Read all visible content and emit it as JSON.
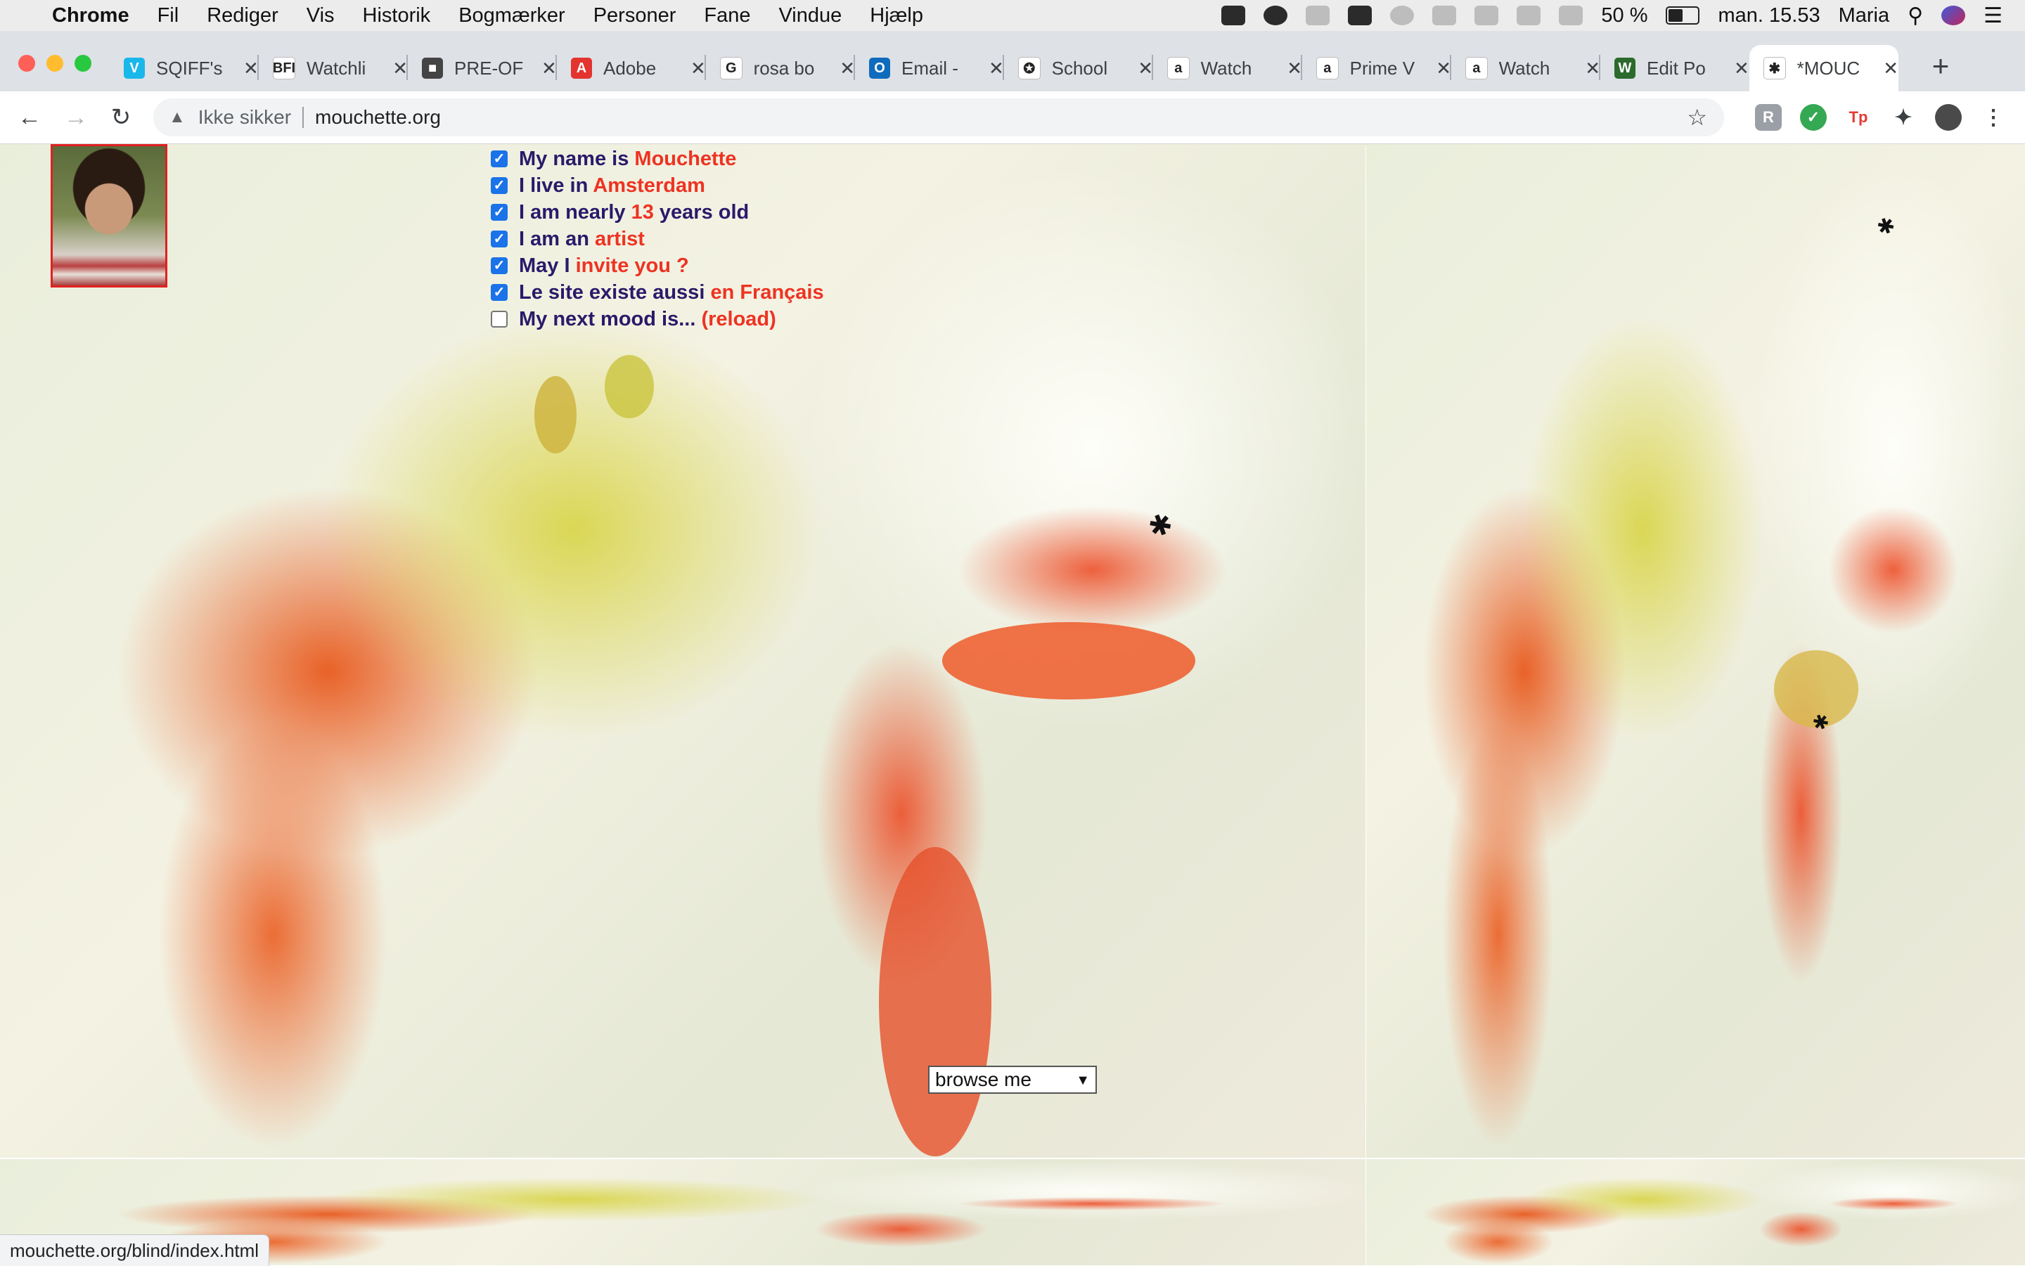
{
  "menubar": {
    "app_name": "Chrome",
    "items": [
      "Fil",
      "Rediger",
      "Vis",
      "Historik",
      "Bogmærker",
      "Personer",
      "Fane",
      "Vindue",
      "Hjælp"
    ],
    "battery": "50 %",
    "clock": "man. 15.53",
    "user": "Maria"
  },
  "tabs": [
    {
      "title": "SQIFF's",
      "favicon": "vimeo-icon",
      "color": "#1ab7ea",
      "glyph": "V"
    },
    {
      "title": "Watchli",
      "favicon": "bfi-icon",
      "color": "#ffffff",
      "glyph": "BFI"
    },
    {
      "title": "PRE-OF",
      "favicon": "box-icon",
      "color": "#444444",
      "glyph": "■"
    },
    {
      "title": "Adobe",
      "favicon": "adobe-icon",
      "color": "#e3342f",
      "glyph": "A"
    },
    {
      "title": "rosa bo",
      "favicon": "google-icon",
      "color": "#ffffff",
      "glyph": "G"
    },
    {
      "title": "Email -",
      "favicon": "outlook-icon",
      "color": "#0f6cbd",
      "glyph": "O"
    },
    {
      "title": "School",
      "favicon": "school-crest-icon",
      "color": "#ffffff",
      "glyph": "✪"
    },
    {
      "title": "Watch",
      "favicon": "amazon-icon",
      "color": "#ffffff",
      "glyph": "a"
    },
    {
      "title": "Prime V",
      "favicon": "amazon-icon",
      "color": "#ffffff",
      "glyph": "a"
    },
    {
      "title": "Watch",
      "favicon": "amazon-icon",
      "color": "#ffffff",
      "glyph": "a"
    },
    {
      "title": "Edit Po",
      "favicon": "editor-icon",
      "color": "#2d6a2d",
      "glyph": "W"
    },
    {
      "title": "*MOUC",
      "favicon": "fly-icon",
      "color": "#ffffff",
      "glyph": "✱"
    }
  ],
  "active_tab_index": 11,
  "omnibox": {
    "security_label": "Ikke sikker",
    "url": "mouchette.org"
  },
  "checklist": [
    {
      "checked": true,
      "text": "My name is ",
      "highlight": "Mouchette",
      "suffix": ""
    },
    {
      "checked": true,
      "text": "I live in ",
      "highlight": "Amsterdam",
      "suffix": ""
    },
    {
      "checked": true,
      "text": "I am nearly ",
      "highlight": "13",
      "suffix": " years old"
    },
    {
      "checked": true,
      "text": "I am an ",
      "highlight": "artist",
      "suffix": ""
    },
    {
      "checked": true,
      "text": "May I ",
      "highlight": "invite you ?",
      "suffix": ""
    },
    {
      "checked": true,
      "text": "Le site existe aussi ",
      "highlight": "en Français",
      "suffix": ""
    },
    {
      "checked": false,
      "text": "My next mood is... ",
      "highlight": "(reload)",
      "suffix": ""
    }
  ],
  "browse_select": {
    "selected": "browse me"
  },
  "status_url": "mouchette.org/blind/index.html",
  "colors": {
    "highlight_text": "#ee3322",
    "body_text": "#2a1a6a",
    "checkbox": "#1a73e8"
  }
}
